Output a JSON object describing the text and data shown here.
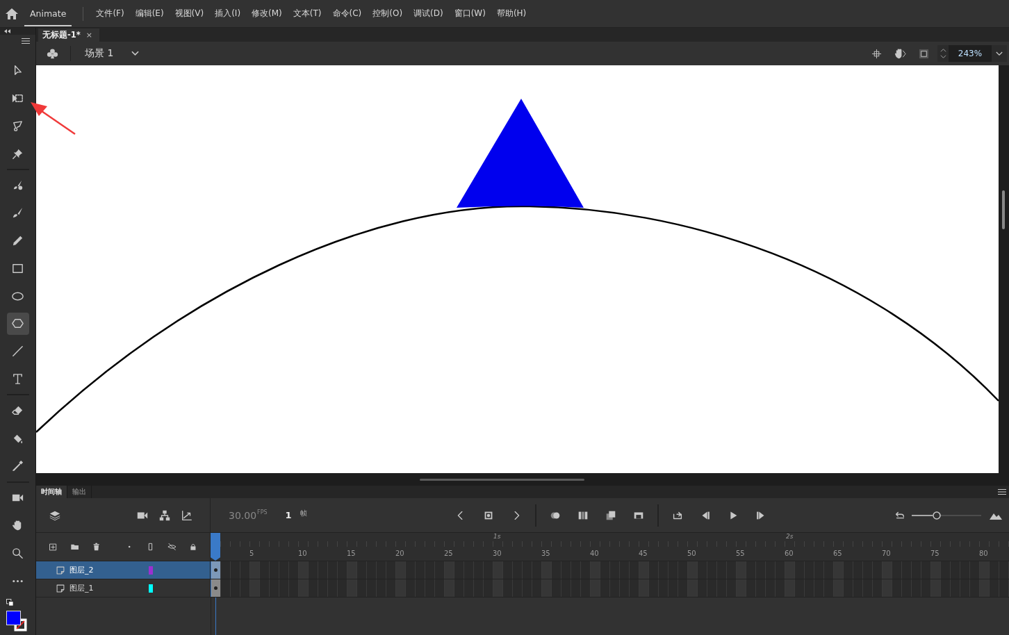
{
  "app": {
    "name": "Animate"
  },
  "menu": [
    "文件(F)",
    "编辑(E)",
    "视图(V)",
    "插入(I)",
    "修改(M)",
    "文本(T)",
    "命令(C)",
    "控制(O)",
    "调试(D)",
    "窗口(W)",
    "帮助(H)"
  ],
  "document_tab": {
    "title": "无标题-1*",
    "close": "×"
  },
  "scene": {
    "label": "场景 1"
  },
  "zoom": {
    "value": "243%"
  },
  "tools": [
    {
      "kind": "arrow",
      "selected": false
    },
    {
      "kind": "transform",
      "selected": false
    },
    {
      "kind": "lasso",
      "selected": false
    },
    {
      "kind": "pin",
      "selected": false
    },
    {
      "kind": "paintbrush",
      "selected": false
    },
    {
      "kind": "brush",
      "selected": false
    },
    {
      "kind": "pencil",
      "selected": false
    },
    {
      "kind": "rectangle",
      "selected": false
    },
    {
      "kind": "oval",
      "selected": false
    },
    {
      "kind": "polygon",
      "selected": true
    },
    {
      "kind": "line",
      "selected": false
    },
    {
      "kind": "text",
      "selected": false
    },
    {
      "kind": "eraser",
      "selected": false
    },
    {
      "kind": "bucket",
      "selected": false
    },
    {
      "kind": "eyedropper",
      "selected": false
    },
    {
      "kind": "camera",
      "selected": false
    },
    {
      "kind": "hand",
      "selected": false
    },
    {
      "kind": "zoom",
      "selected": false
    },
    {
      "kind": "more",
      "selected": false
    }
  ],
  "zoom_slider": {
    "level": 0.36
  },
  "timeline": {
    "tabs": [
      {
        "label": "时间轴",
        "selected": true
      },
      {
        "label": "输出",
        "selected": false
      }
    ],
    "fps": "30.00",
    "fps_unit": "FPS",
    "frame": "1",
    "frame_unit": "帧",
    "seconds": [
      "1s",
      "2s"
    ],
    "ruler": [
      "5",
      "10",
      "15",
      "20",
      "25",
      "30",
      "35",
      "40",
      "45",
      "50",
      "55",
      "60",
      "65",
      "70",
      "75",
      "80"
    ],
    "layers": [
      {
        "name": "图层_2",
        "color": "#9b30d0",
        "selected": true
      },
      {
        "name": "图层_1",
        "color": "#00ffff",
        "selected": false
      }
    ]
  }
}
